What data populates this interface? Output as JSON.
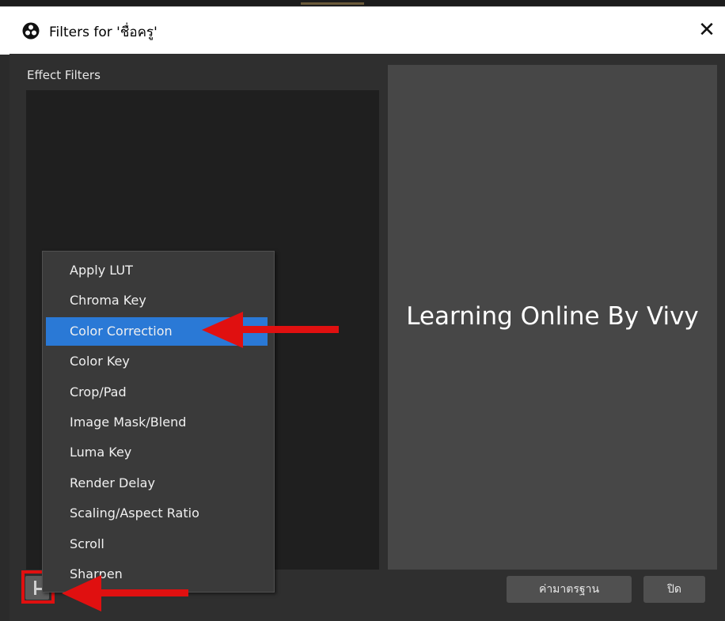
{
  "window": {
    "title": "Filters for 'ชื่อครู'",
    "close_glyph": "✕"
  },
  "dialog": {
    "section_label": "Effect Filters",
    "preview_text": "Learning Online By Vivy",
    "buttons": {
      "defaults_label": "ค่ามาตรฐาน",
      "close_label": "ปิด"
    }
  },
  "menu": {
    "items": [
      {
        "label": "Apply LUT",
        "selected": false
      },
      {
        "label": "Chroma Key",
        "selected": false
      },
      {
        "label": "Color Correction",
        "selected": true
      },
      {
        "label": "Color Key",
        "selected": false
      },
      {
        "label": "Crop/Pad",
        "selected": false
      },
      {
        "label": "Image Mask/Blend",
        "selected": false
      },
      {
        "label": "Luma Key",
        "selected": false
      },
      {
        "label": "Render Delay",
        "selected": false
      },
      {
        "label": "Scaling/Aspect Ratio",
        "selected": false
      },
      {
        "label": "Scroll",
        "selected": false
      },
      {
        "label": "Sharpen",
        "selected": false
      }
    ]
  },
  "colors": {
    "selection": "#2a79d6",
    "annotation_red": "#e01010"
  },
  "icons": {
    "app": "obs-logo-icon",
    "add": "add-filter-icon"
  }
}
